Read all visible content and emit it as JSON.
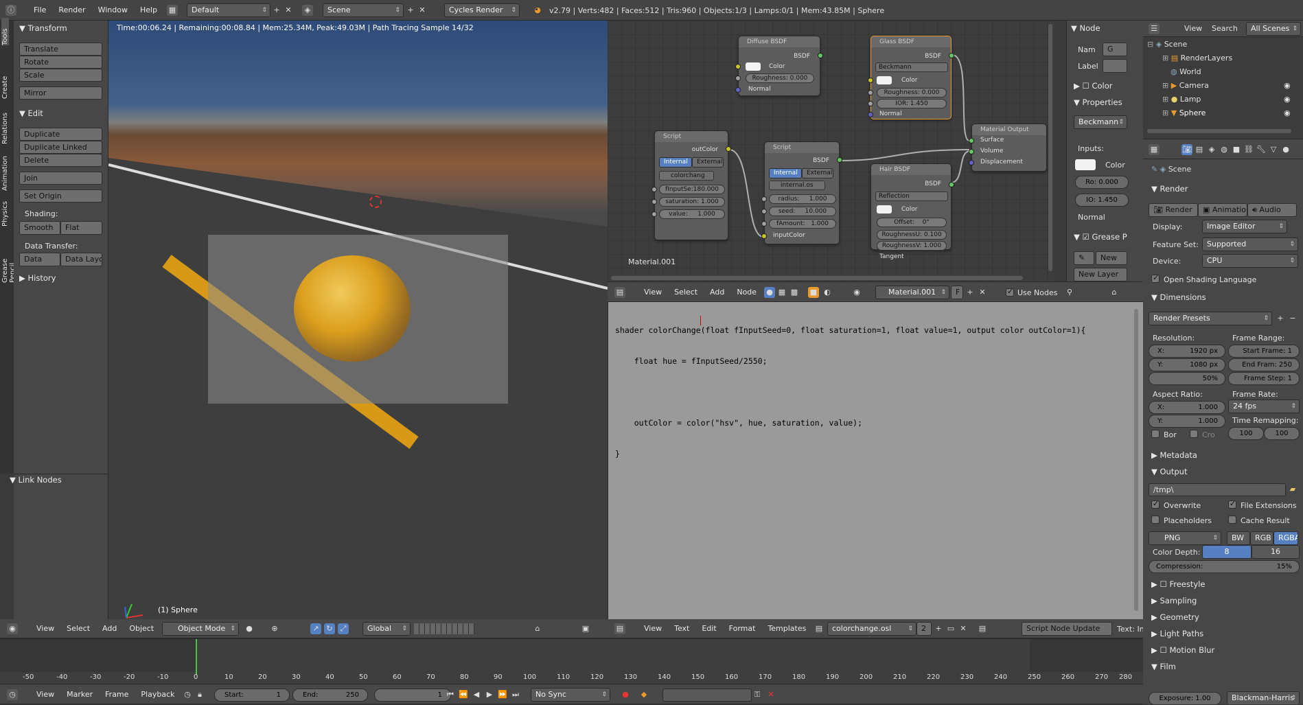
{
  "topbar": {
    "menus": [
      "File",
      "Render",
      "Window",
      "Help"
    ],
    "layout": "Default",
    "scene": "Scene",
    "engine": "Cycles Render",
    "stats": "v2.79 | Verts:482 | Faces:512 | Tris:960 | Objects:1/3 | Lamps:0/1 | Mem:43.85M | Sphere"
  },
  "tool_tabs": [
    "Tools",
    "Create",
    "Relations",
    "Animation",
    "Physics",
    "Grease Pencil"
  ],
  "tools": {
    "transform": "Transform",
    "translate": "Translate",
    "rotate": "Rotate",
    "scale": "Scale",
    "mirror": "Mirror",
    "edit": "Edit",
    "duplicate": "Duplicate",
    "duplicate_linked": "Duplicate Linked",
    "delete": "Delete",
    "join": "Join",
    "set_origin": "Set Origin",
    "shading": "Shading:",
    "smooth": "Smooth",
    "flat": "Flat",
    "data_transfer": "Data Transfer:",
    "data": "Data",
    "data_layo": "Data Layo",
    "history": "History",
    "link_nodes": "Link Nodes"
  },
  "viewport": {
    "status": "Time:00:06.24 | Remaining:00:08.84 | Mem:25.34M, Peak:49.03M | Path Tracing Sample 14/32",
    "object_label": "(1) Sphere",
    "menus": [
      "View",
      "Select",
      "Add",
      "Object"
    ],
    "mode": "Object Mode",
    "orientation": "Global"
  },
  "node_editor": {
    "material_label": "Material.001",
    "diffuse": {
      "title": "Diffuse BSDF",
      "out": "BSDF",
      "color": "Color",
      "roughness": "Roughness:",
      "roughness_val": "0.000",
      "normal": "Normal"
    },
    "glass": {
      "title": "Glass BSDF",
      "out": "BSDF",
      "dist": "Beckmann",
      "color": "Color",
      "roughness": "Roughness:",
      "roughness_val": "0.000",
      "ior": "IOR:",
      "ior_val": "1.450",
      "normal": "Normal"
    },
    "script1": {
      "title": "Script",
      "out": "outColor",
      "internal": "Internal",
      "external": "External",
      "file": "colorchang",
      "f1": "fInputSe:180.000",
      "f2": "saturation: 1.000",
      "f3": "value:",
      "f3v": "1.000"
    },
    "script2": {
      "title": "Script",
      "out": "BSDF",
      "internal": "Internal",
      "external": "External",
      "file": "internal.os",
      "f1": "radius:",
      "f1v": "1.000",
      "f2": "seed:",
      "f2v": "10.000",
      "f3": "fAmount:",
      "f3v": "1.000",
      "in": "inputColor"
    },
    "hair": {
      "title": "Hair BSDF",
      "out": "BSDF",
      "dist": "Reflection",
      "color": "Color",
      "offset": "Offset:",
      "offset_val": "0°",
      "ru": "RoughnessU: 0.100",
      "rv": "RoughnessV: 1.000",
      "tangent": "Tangent"
    },
    "output": {
      "title": "Material Output",
      "surface": "Surface",
      "volume": "Volume",
      "displacement": "Displacement"
    }
  },
  "node_panel": {
    "node": "Node",
    "name": "Nam",
    "label": "Label",
    "color": "Color",
    "properties": "Properties",
    "dist": "Beckmann",
    "inputs": "Inputs:",
    "color_lbl": "Color",
    "ro": "Ro: 0.000",
    "io": "IO: 1.450",
    "normal": "Normal",
    "grease": "Grease P",
    "new": "New",
    "new_layer": "New Layer"
  },
  "node_header": {
    "menus": [
      "View",
      "Select",
      "Add",
      "Node"
    ],
    "material": "Material.001",
    "f": "F",
    "use_nodes": "Use Nodes"
  },
  "code": [
    "shader colorChange(float fInputSeed=0, float saturation=1, float value=1, output color outColor=1){",
    "    float hue = fInputSeed/2550;",
    "",
    "    outColor = color(\"hsv\", hue, saturation, value);",
    "}"
  ],
  "text_header": {
    "menus": [
      "View",
      "Text",
      "Edit",
      "Format",
      "Templates"
    ],
    "file": "colorchange.osl",
    "users": "2",
    "script_update": "Script Node Update",
    "text": "Text: In"
  },
  "timeline": {
    "ticks": [
      "-50",
      "-40",
      "-30",
      "-20",
      "-10",
      "0",
      "10",
      "20",
      "30",
      "40",
      "50",
      "60",
      "70",
      "80",
      "90",
      "100",
      "110",
      "120",
      "130",
      "140",
      "150",
      "160",
      "170",
      "180",
      "190",
      "200",
      "210",
      "220",
      "230",
      "240",
      "250",
      "260",
      "270",
      "280"
    ],
    "menus": [
      "View",
      "Marker",
      "Frame",
      "Playback"
    ],
    "start": "Start:",
    "start_val": "1",
    "end": "End:",
    "end_val": "250",
    "current": "1",
    "sync": "No Sync"
  },
  "outliner": {
    "menus": [
      "View",
      "Search",
      "All Scenes"
    ],
    "items": [
      "Scene",
      "RenderLayers",
      "World",
      "Camera",
      "Lamp",
      "Sphere"
    ]
  },
  "props": {
    "scene": "Scene",
    "render": "Render",
    "render_btn": "Render",
    "animation_btn": "Animation",
    "audio_btn": "Audio",
    "display": "Display:",
    "display_val": "Image Editor",
    "feature_set": "Feature Set:",
    "feature_val": "Supported",
    "device": "Device:",
    "device_val": "CPU",
    "osl": "Open Shading Language",
    "dimensions": "Dimensions",
    "render_presets": "Render Presets",
    "resolution": "Resolution:",
    "frame_range": "Frame Range:",
    "res_x": "X:",
    "res_x_val": "1920 px",
    "res_y": "Y:",
    "res_y_val": "1080 px",
    "res_pct": "50%",
    "start_frame": "Start Frame:",
    "start_frame_val": "1",
    "end_frame": "End Fram: 250",
    "frame_step": "Frame Step:",
    "frame_step_val": "1",
    "aspect": "Aspect Ratio:",
    "frame_rate": "Frame Rate:",
    "asp_x": "X:",
    "asp_x_val": "1.000",
    "asp_y": "Y:",
    "asp_y_val": "1.000",
    "fps": "24 fps",
    "time_remap": "Time Remapping:",
    "remap_old": "100",
    "remap_new": "100",
    "bor": "Bor",
    "cro": "Cro",
    "metadata": "Metadata",
    "output": "Output",
    "path": "/tmp\\",
    "overwrite": "Overwrite",
    "file_ext": "File Extensions",
    "placeholders": "Placeholders",
    "cache": "Cache Result",
    "format": "PNG",
    "bw": "BW",
    "rgb": "RGB",
    "rgba": "RGBA",
    "color_depth": "Color Depth:",
    "depth8": "8",
    "depth16": "16",
    "compression": "Compression:",
    "compression_val": "15%",
    "freestyle": "Freestyle",
    "sampling": "Sampling",
    "geometry": "Geometry",
    "light_paths": "Light Paths",
    "motion_blur": "Motion Blur",
    "film": "Film",
    "exposure": "Exposure: 1.00",
    "filter": "Blackman-Harris"
  }
}
